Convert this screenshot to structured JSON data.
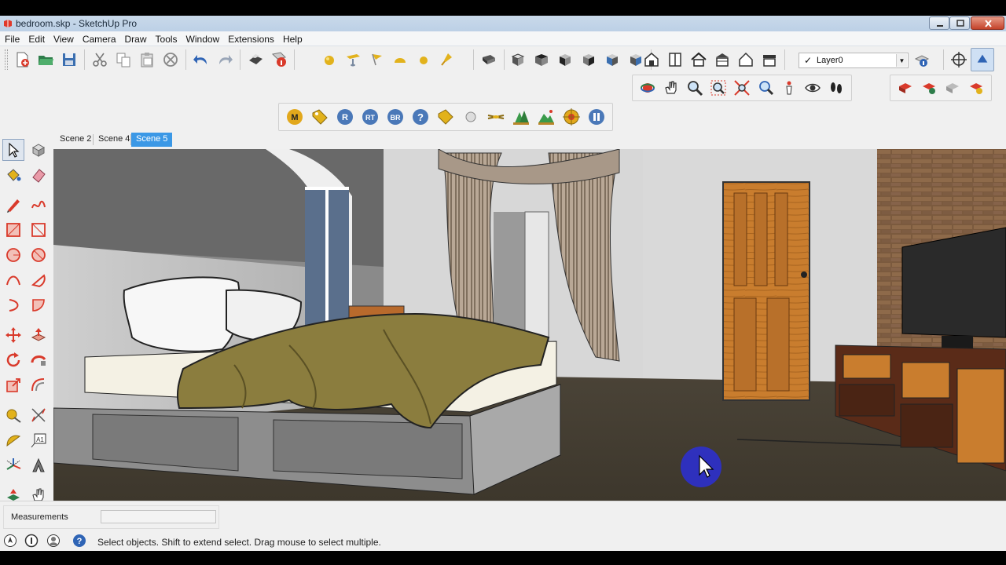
{
  "window": {
    "title": "bedroom.skp - SketchUp Pro"
  },
  "menu": [
    "File",
    "Edit",
    "View",
    "Camera",
    "Draw",
    "Tools",
    "Window",
    "Extensions",
    "Help"
  ],
  "toolbar_main": {
    "icons": [
      "new-file-icon",
      "open-folder-icon",
      "save-icon",
      "cut-icon",
      "copy-icon",
      "paste-icon",
      "erase-circle-icon",
      "undo-icon",
      "redo-icon",
      "print-icon",
      "model-info-icon"
    ]
  },
  "toolbar_styles": {
    "icons": [
      "sphere-icon",
      "paint-tray-icon",
      "flag-icon",
      "dome-icon",
      "sphere-small-icon",
      "torch-icon"
    ]
  },
  "toolbar_views": {
    "icons": [
      "iso-view-icon",
      "top-view-icon",
      "front-view-icon",
      "right-view-icon",
      "back-view-icon",
      "left-view-icon"
    ]
  },
  "toolbar_warehouse": {
    "icons": [
      "warehouse-house-icon",
      "components-icon",
      "home-icon",
      "store-icon",
      "house-outline-icon",
      "roof-icon"
    ]
  },
  "layer": {
    "name": "Layer0",
    "checked": "✓"
  },
  "toolbar_camera": {
    "icons": [
      "orbit-icon",
      "pan-hand-icon",
      "zoom-icon",
      "zoom-window-icon",
      "zoom-extents-icon",
      "zoom-previous-icon",
      "position-camera-icon",
      "look-around-icon",
      "walk-icon"
    ]
  },
  "toolbar_plugins": {
    "icons": [
      "m-icon",
      "tag-icon",
      "r-icon",
      "rt-icon",
      "br-icon",
      "help-icon",
      "label-icon",
      "light-icon",
      "fly-icon",
      "tree-icon",
      "landscape-icon",
      "target-icon",
      "pause-icon"
    ],
    "labels": {
      "m": "M",
      "r": "R",
      "rt": "RT",
      "br": "BR",
      "help": "?"
    }
  },
  "scene_tabs": [
    "Scene 2",
    "Scene 4",
    "Scene 5"
  ],
  "active_scene": "Scene 5",
  "left_tools": [
    "select-icon",
    "component-icon",
    "paint-bucket-icon",
    "eraser-icon",
    "pencil-icon",
    "freehand-icon",
    "rectangle-icon",
    "rotated-rect-icon",
    "circle-icon",
    "polygon-icon",
    "arc-icon",
    "pie-icon",
    "arc3-icon",
    "arc2-icon",
    "move-icon",
    "push-pull-icon",
    "rotate-icon",
    "follow-me-icon",
    "scale-icon",
    "offset-icon",
    "tape-measure-icon",
    "dimension-icon",
    "protractor-icon",
    "text-icon",
    "axes-icon",
    "3d-text-icon",
    "section-icon",
    "sandbox-icon"
  ],
  "status": {
    "measurements_label": "Measurements",
    "measurements_value": "",
    "hint": "Select objects. Shift to extend select. Drag mouse to select multiple."
  },
  "colors": {
    "accent_tab": "#3b98e6",
    "cursor_highlight": "#2b2fd6"
  }
}
